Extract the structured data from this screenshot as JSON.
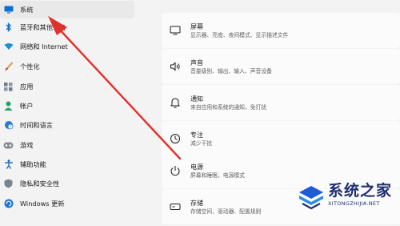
{
  "sidebar": {
    "items": [
      {
        "label": "系统",
        "icon": "monitor-icon",
        "active": true
      },
      {
        "label": "蓝牙和其他设备",
        "icon": "bluetooth-icon"
      },
      {
        "label": "网络和 Internet",
        "icon": "wifi-icon"
      },
      {
        "label": "个性化",
        "icon": "paintbrush-icon"
      },
      {
        "label": "应用",
        "icon": "apps-icon"
      },
      {
        "label": "帐户",
        "icon": "person-icon"
      },
      {
        "label": "时间和语言",
        "icon": "globe-clock-icon"
      },
      {
        "label": "游戏",
        "icon": "gamepad-icon"
      },
      {
        "label": "辅助功能",
        "icon": "accessibility-icon"
      },
      {
        "label": "隐私和安全性",
        "icon": "shield-icon"
      },
      {
        "label": "Windows 更新",
        "icon": "update-icon"
      }
    ]
  },
  "settings": [
    {
      "title": "屏幕",
      "desc": "显示器、亮度、夜间模式、显示描述文件",
      "icon": "display-icon"
    },
    {
      "title": "声音",
      "desc": "音量级别、输出、输入、声音设备",
      "icon": "speaker-icon"
    },
    {
      "title": "通知",
      "desc": "来自应用和系统的通知，免打扰",
      "icon": "bell-icon"
    },
    {
      "title": "专注",
      "desc": "减少干扰",
      "icon": "focus-icon"
    },
    {
      "title": "电源",
      "desc": "屏幕和睡眠，电源模式",
      "icon": "power-icon"
    },
    {
      "title": "存储",
      "desc": "存储空间、驱动器、配置规则",
      "icon": "storage-icon"
    }
  ],
  "watermark": {
    "title": "系统之家",
    "url": "XITONGZHIJIA.NET"
  },
  "colors": {
    "arrow": "#e2302a",
    "accent": "#0067c0",
    "watermark": "#1d2f6f"
  }
}
